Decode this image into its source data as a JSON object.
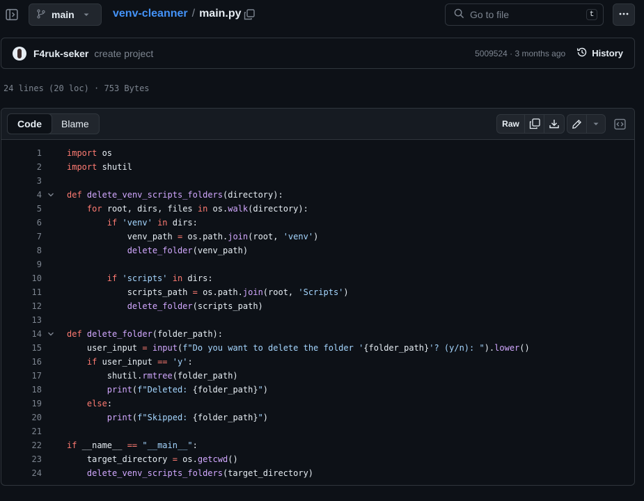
{
  "header": {
    "branch": "main",
    "repo": "venv-cleanner",
    "separator": "/",
    "file": "main.py",
    "goto_placeholder": "Go to file",
    "goto_shortcut": "t"
  },
  "commit": {
    "author": "F4ruk-seker",
    "message": "create project",
    "meta": "5009524 · 3 months ago",
    "history_label": "History"
  },
  "file_info": "24 lines (20 loc) · 753 Bytes",
  "viewer": {
    "tabs": [
      "Code",
      "Blame"
    ],
    "raw_label": "Raw"
  },
  "code": {
    "lines": [
      {
        "n": "1",
        "fold": false,
        "tokens": [
          {
            "t": "import",
            "c": "kw"
          },
          {
            "t": " os",
            "c": "txt"
          }
        ]
      },
      {
        "n": "2",
        "fold": false,
        "tokens": [
          {
            "t": "import",
            "c": "kw"
          },
          {
            "t": " shutil",
            "c": "txt"
          }
        ]
      },
      {
        "n": "3",
        "fold": false,
        "tokens": []
      },
      {
        "n": "4",
        "fold": true,
        "tokens": [
          {
            "t": "def",
            "c": "kw"
          },
          {
            "t": " ",
            "c": "txt"
          },
          {
            "t": "delete_venv_scripts_folders",
            "c": "fn"
          },
          {
            "t": "(directory):",
            "c": "txt"
          }
        ]
      },
      {
        "n": "5",
        "fold": false,
        "tokens": [
          {
            "t": "    ",
            "c": "txt"
          },
          {
            "t": "for",
            "c": "kw"
          },
          {
            "t": " root, dirs, files ",
            "c": "txt"
          },
          {
            "t": "in",
            "c": "kw"
          },
          {
            "t": " os.",
            "c": "txt"
          },
          {
            "t": "walk",
            "c": "fn"
          },
          {
            "t": "(directory):",
            "c": "txt"
          }
        ]
      },
      {
        "n": "6",
        "fold": false,
        "tokens": [
          {
            "t": "        ",
            "c": "txt"
          },
          {
            "t": "if",
            "c": "kw"
          },
          {
            "t": " ",
            "c": "txt"
          },
          {
            "t": "'venv'",
            "c": "str"
          },
          {
            "t": " ",
            "c": "txt"
          },
          {
            "t": "in",
            "c": "kw"
          },
          {
            "t": " dirs:",
            "c": "txt"
          }
        ]
      },
      {
        "n": "7",
        "fold": false,
        "tokens": [
          {
            "t": "            venv_path ",
            "c": "txt"
          },
          {
            "t": "=",
            "c": "op"
          },
          {
            "t": " os.path.",
            "c": "txt"
          },
          {
            "t": "join",
            "c": "fn"
          },
          {
            "t": "(root, ",
            "c": "txt"
          },
          {
            "t": "'venv'",
            "c": "str"
          },
          {
            "t": ")",
            "c": "txt"
          }
        ]
      },
      {
        "n": "8",
        "fold": false,
        "tokens": [
          {
            "t": "            ",
            "c": "txt"
          },
          {
            "t": "delete_folder",
            "c": "fn"
          },
          {
            "t": "(venv_path)",
            "c": "txt"
          }
        ]
      },
      {
        "n": "9",
        "fold": false,
        "tokens": []
      },
      {
        "n": "10",
        "fold": false,
        "tokens": [
          {
            "t": "        ",
            "c": "txt"
          },
          {
            "t": "if",
            "c": "kw"
          },
          {
            "t": " ",
            "c": "txt"
          },
          {
            "t": "'scripts'",
            "c": "str"
          },
          {
            "t": " ",
            "c": "txt"
          },
          {
            "t": "in",
            "c": "kw"
          },
          {
            "t": " dirs:",
            "c": "txt"
          }
        ]
      },
      {
        "n": "11",
        "fold": false,
        "tokens": [
          {
            "t": "            scripts_path ",
            "c": "txt"
          },
          {
            "t": "=",
            "c": "op"
          },
          {
            "t": " os.path.",
            "c": "txt"
          },
          {
            "t": "join",
            "c": "fn"
          },
          {
            "t": "(root, ",
            "c": "txt"
          },
          {
            "t": "'Scripts'",
            "c": "str"
          },
          {
            "t": ")",
            "c": "txt"
          }
        ]
      },
      {
        "n": "12",
        "fold": false,
        "tokens": [
          {
            "t": "            ",
            "c": "txt"
          },
          {
            "t": "delete_folder",
            "c": "fn"
          },
          {
            "t": "(scripts_path)",
            "c": "txt"
          }
        ]
      },
      {
        "n": "13",
        "fold": false,
        "tokens": []
      },
      {
        "n": "14",
        "fold": true,
        "tokens": [
          {
            "t": "def",
            "c": "kw"
          },
          {
            "t": " ",
            "c": "txt"
          },
          {
            "t": "delete_folder",
            "c": "fn"
          },
          {
            "t": "(folder_path):",
            "c": "txt"
          }
        ]
      },
      {
        "n": "15",
        "fold": false,
        "tokens": [
          {
            "t": "    user_input ",
            "c": "txt"
          },
          {
            "t": "=",
            "c": "op"
          },
          {
            "t": " ",
            "c": "txt"
          },
          {
            "t": "input",
            "c": "fn"
          },
          {
            "t": "(",
            "c": "txt"
          },
          {
            "t": "f\"Do you want to delete the folder '",
            "c": "str"
          },
          {
            "t": "{folder_path}",
            "c": "txt"
          },
          {
            "t": "'? (y/n): \"",
            "c": "str"
          },
          {
            "t": ").",
            "c": "txt"
          },
          {
            "t": "lower",
            "c": "fn"
          },
          {
            "t": "()",
            "c": "txt"
          }
        ]
      },
      {
        "n": "16",
        "fold": false,
        "tokens": [
          {
            "t": "    ",
            "c": "txt"
          },
          {
            "t": "if",
            "c": "kw"
          },
          {
            "t": " user_input ",
            "c": "txt"
          },
          {
            "t": "==",
            "c": "op"
          },
          {
            "t": " ",
            "c": "txt"
          },
          {
            "t": "'y'",
            "c": "str"
          },
          {
            "t": ":",
            "c": "txt"
          }
        ]
      },
      {
        "n": "17",
        "fold": false,
        "tokens": [
          {
            "t": "        shutil.",
            "c": "txt"
          },
          {
            "t": "rmtree",
            "c": "fn"
          },
          {
            "t": "(folder_path)",
            "c": "txt"
          }
        ]
      },
      {
        "n": "18",
        "fold": false,
        "tokens": [
          {
            "t": "        ",
            "c": "txt"
          },
          {
            "t": "print",
            "c": "fn"
          },
          {
            "t": "(",
            "c": "txt"
          },
          {
            "t": "f\"Deleted: ",
            "c": "str"
          },
          {
            "t": "{folder_path}",
            "c": "txt"
          },
          {
            "t": "\"",
            "c": "str"
          },
          {
            "t": ")",
            "c": "txt"
          }
        ]
      },
      {
        "n": "19",
        "fold": false,
        "tokens": [
          {
            "t": "    ",
            "c": "txt"
          },
          {
            "t": "else",
            "c": "kw"
          },
          {
            "t": ":",
            "c": "txt"
          }
        ]
      },
      {
        "n": "20",
        "fold": false,
        "tokens": [
          {
            "t": "        ",
            "c": "txt"
          },
          {
            "t": "print",
            "c": "fn"
          },
          {
            "t": "(",
            "c": "txt"
          },
          {
            "t": "f\"Skipped: ",
            "c": "str"
          },
          {
            "t": "{folder_path}",
            "c": "txt"
          },
          {
            "t": "\"",
            "c": "str"
          },
          {
            "t": ")",
            "c": "txt"
          }
        ]
      },
      {
        "n": "21",
        "fold": false,
        "tokens": []
      },
      {
        "n": "22",
        "fold": false,
        "tokens": [
          {
            "t": "if",
            "c": "kw"
          },
          {
            "t": " __name__ ",
            "c": "txt"
          },
          {
            "t": "==",
            "c": "op"
          },
          {
            "t": " ",
            "c": "txt"
          },
          {
            "t": "\"__main__\"",
            "c": "str"
          },
          {
            "t": ":",
            "c": "txt"
          }
        ]
      },
      {
        "n": "23",
        "fold": false,
        "tokens": [
          {
            "t": "    target_directory ",
            "c": "txt"
          },
          {
            "t": "=",
            "c": "op"
          },
          {
            "t": " os.",
            "c": "txt"
          },
          {
            "t": "getcwd",
            "c": "fn"
          },
          {
            "t": "()",
            "c": "txt"
          }
        ]
      },
      {
        "n": "24",
        "fold": false,
        "tokens": [
          {
            "t": "    ",
            "c": "txt"
          },
          {
            "t": "delete_venv_scripts_folders",
            "c": "fn"
          },
          {
            "t": "(target_directory)",
            "c": "txt"
          }
        ]
      }
    ]
  }
}
